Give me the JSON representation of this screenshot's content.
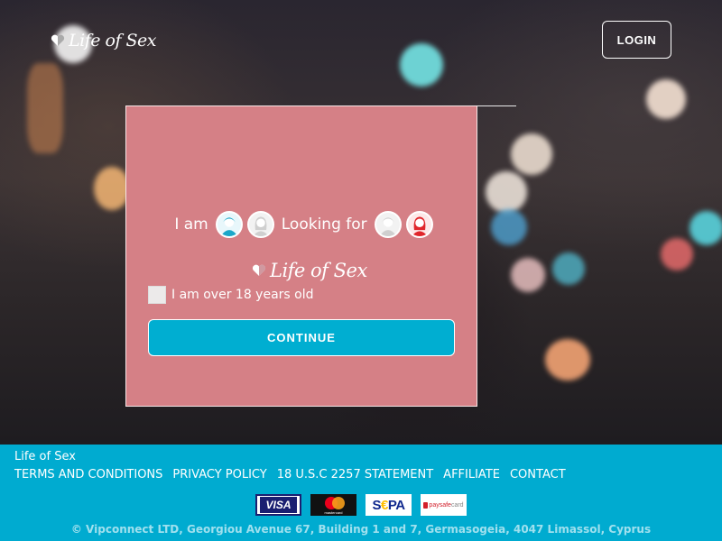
{
  "header": {
    "logo_text": "Life of Sex",
    "login_label": "LOGIN"
  },
  "modal": {
    "logo_text": "Life of Sex",
    "i_am_label": "I am",
    "looking_for_label": "Looking for",
    "age_confirm_label": "I am over 18 years old",
    "continue_label": "CONTINUE"
  },
  "footer": {
    "brand": "Life of Sex",
    "links": [
      "TERMS AND CONDITIONS",
      "PRIVACY POLICY",
      "18 U.S.C 2257 STATEMENT",
      "AFFILIATE",
      "CONTACT"
    ],
    "payments": {
      "visa": "VISA",
      "mastercard": "mastercard",
      "sepa_s": "S",
      "sepa_euro": "€",
      "sepa_pa": "PA",
      "paysafe": "paysafe",
      "paysafe_card": "card"
    },
    "copyright": "© Vipconnect LTD, Georgiou Avenue 67, Building 1 and 7, Germasogeia, 4047 Limassol, Cyprus"
  },
  "colors": {
    "modal_bg": "#d58086",
    "accent": "#00aed1",
    "footer_bg": "#00abd0"
  },
  "icons": [
    "heart-logo-icon",
    "male-avatar-icon",
    "female-avatar-icon"
  ]
}
